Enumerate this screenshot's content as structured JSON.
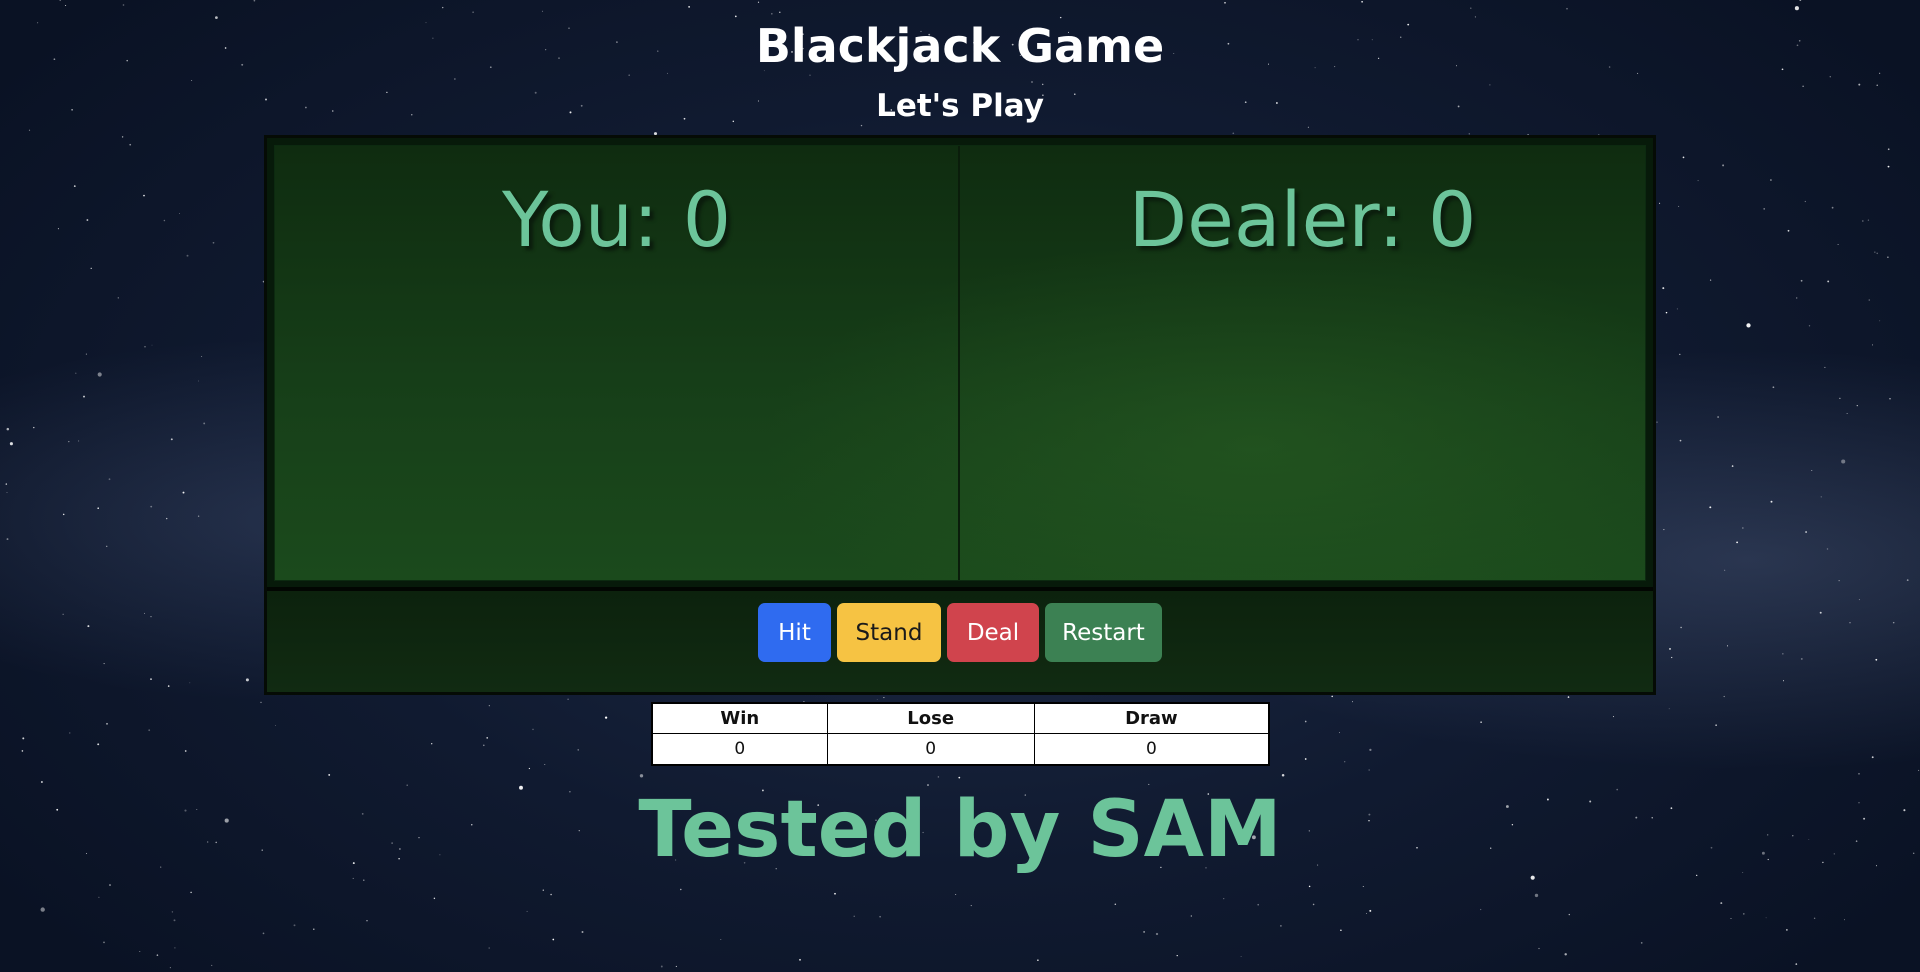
{
  "header": {
    "title": "Blackjack Game",
    "subtitle": "Let's Play"
  },
  "board": {
    "player_label": "You: 0",
    "dealer_label": "Dealer: 0"
  },
  "controls": {
    "hit_label": "Hit",
    "stand_label": "Stand",
    "deal_label": "Deal",
    "restart_label": "Restart"
  },
  "results": {
    "headers": [
      "Win",
      "Lose",
      "Draw"
    ],
    "values": [
      "0",
      "0",
      "0"
    ]
  },
  "footer": {
    "text": "Tested by SAM"
  },
  "colors": {
    "accent_text": "#6cc49a",
    "hit": "#2f6bf0",
    "stand": "#f6c343",
    "deal": "#d0444d",
    "restart": "#3c8153"
  }
}
